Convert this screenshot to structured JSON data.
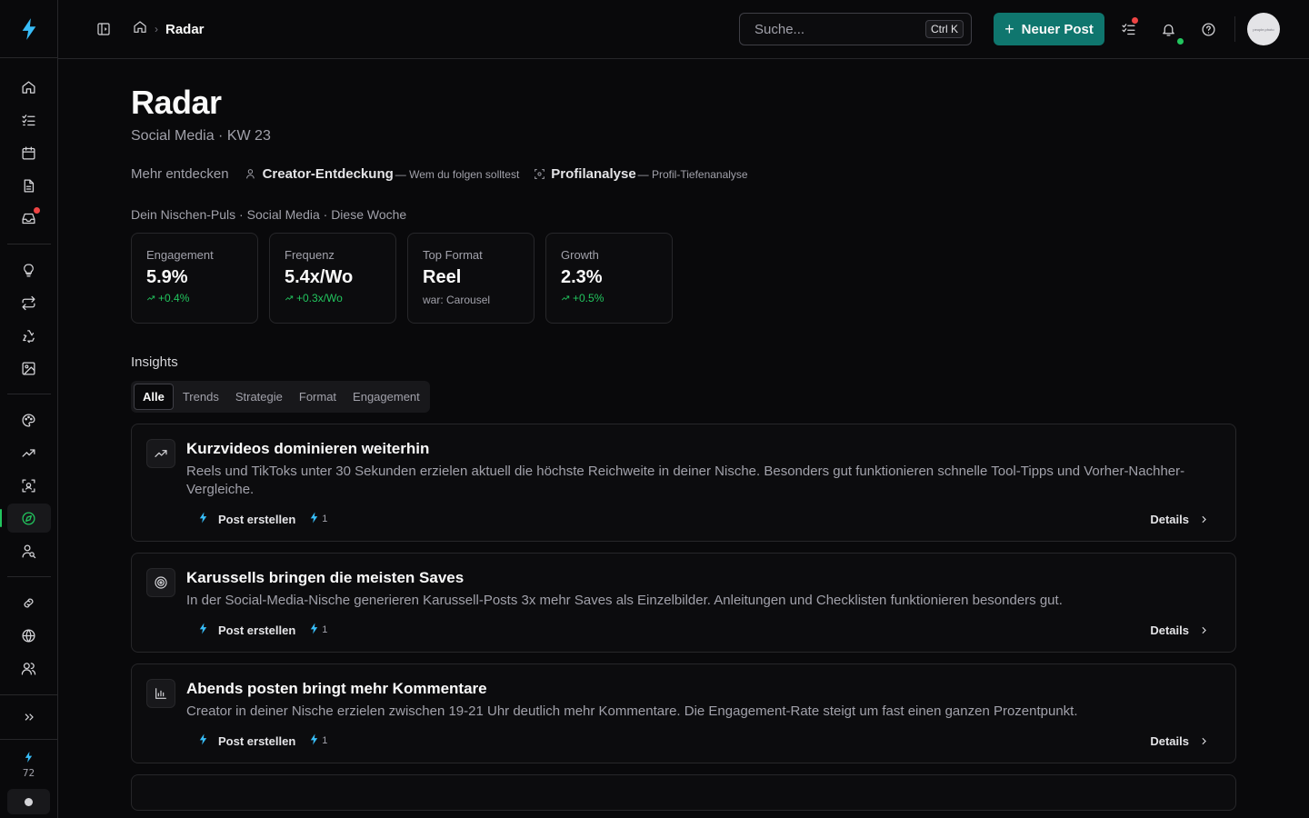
{
  "colors": {
    "accent": "#0f766e",
    "positive": "#22c55e",
    "bolt": "#38bdf8",
    "alert": "#ef4444"
  },
  "sidebar": {
    "logo_icon": "bolt-logo-icon",
    "groups": [
      [
        {
          "icon": "home-icon"
        },
        {
          "icon": "checklist-icon"
        },
        {
          "icon": "calendar-icon"
        },
        {
          "icon": "document-icon"
        },
        {
          "icon": "inbox-icon",
          "badge": true
        }
      ],
      [
        {
          "icon": "lightbulb-icon"
        },
        {
          "icon": "repeat-icon"
        },
        {
          "icon": "recycle-icon"
        },
        {
          "icon": "image-icon"
        }
      ],
      [
        {
          "icon": "palette-icon"
        },
        {
          "icon": "trending-icon"
        },
        {
          "icon": "scan-icon"
        },
        {
          "icon": "compass-icon",
          "active": true
        },
        {
          "icon": "user-search-icon"
        }
      ],
      [
        {
          "icon": "link-icon"
        },
        {
          "icon": "globe-icon"
        },
        {
          "icon": "users-icon"
        }
      ]
    ],
    "credits": "72"
  },
  "topbar": {
    "breadcrumb_current": "Radar",
    "search_placeholder": "Suche...",
    "shortcut": "Ctrl K",
    "new_post_label": "Neuer Post",
    "avatar_text": "people.photo"
  },
  "page": {
    "title": "Radar",
    "subtitle": "Social Media · KW 23"
  },
  "discover": {
    "label": "Mehr entdecken",
    "links": [
      {
        "title": "Creator-Entdeckung",
        "desc": "— Wem du folgen solltest",
        "icon": "user-icon"
      },
      {
        "title": "Profilanalyse",
        "desc": "— Profil-Tiefenanalyse",
        "icon": "scan-icon"
      }
    ]
  },
  "pulse": {
    "label": "Dein Nischen-Puls · Social Media · Diese Woche",
    "stats": [
      {
        "label": "Engagement",
        "value": "5.9%",
        "delta": "+0.4%"
      },
      {
        "label": "Frequenz",
        "value": "5.4x/Wo",
        "delta": "+0.3x/Wo"
      },
      {
        "label": "Top Format",
        "value": "Reel",
        "note": "war: Carousel"
      },
      {
        "label": "Growth",
        "value": "2.3%",
        "delta": "+0.5%"
      }
    ]
  },
  "insights": {
    "label": "Insights",
    "tabs": [
      "Alle",
      "Trends",
      "Strategie",
      "Format",
      "Engagement"
    ],
    "active_tab": "Alle",
    "post_label": "Post erstellen",
    "cost": "1",
    "details_label": "Details",
    "cards": [
      {
        "icon": "trending-up-icon",
        "title": "Kurzvideos dominieren weiterhin",
        "text": "Reels und TikToks unter 30 Sekunden erzielen aktuell die höchste Reichweite in deiner Nische. Besonders gut funktionieren schnelle Tool-Tipps und Vorher-Nachher-Vergleiche."
      },
      {
        "icon": "target-icon",
        "title": "Karussells bringen die meisten Saves",
        "text": "In der Social-Media-Nische generieren Karussell-Posts 3x mehr Saves als Einzelbilder. Anleitungen und Checklisten funktionieren besonders gut."
      },
      {
        "icon": "bar-chart-icon",
        "title": "Abends posten bringt mehr Kommentare",
        "text": "Creator in deiner Nische erzielen zwischen 19-21 Uhr deutlich mehr Kommentare. Die Engagement-Rate steigt um fast einen ganzen Prozentpunkt."
      }
    ]
  }
}
